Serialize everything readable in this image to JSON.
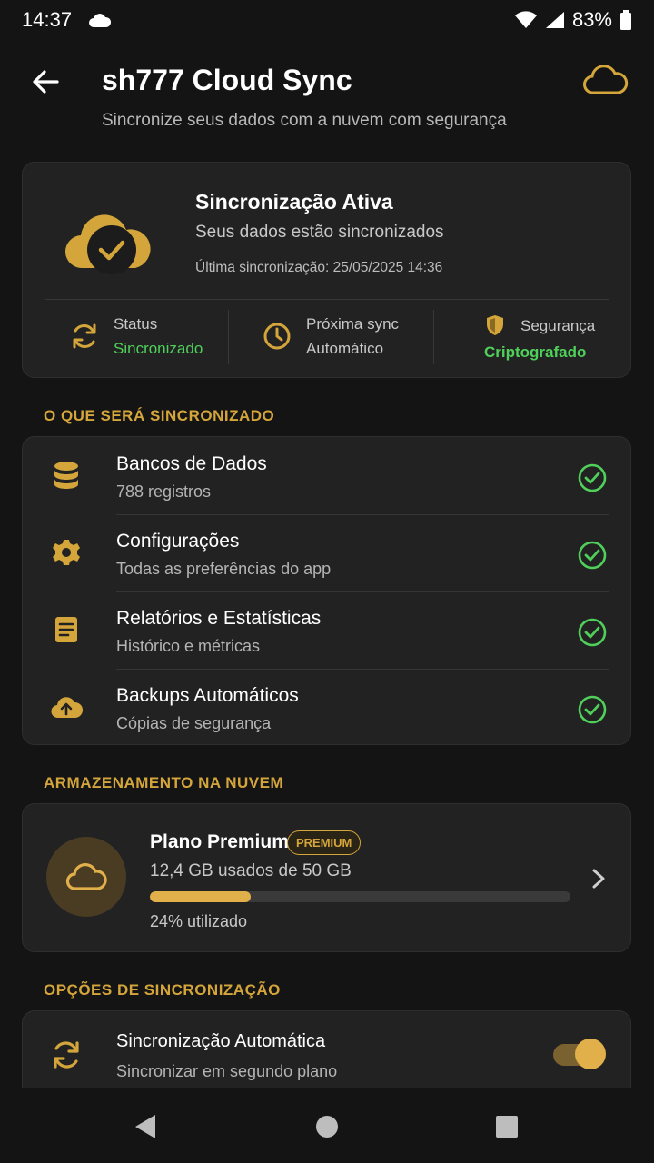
{
  "status_bar": {
    "time": "14:37",
    "battery": "83%"
  },
  "header": {
    "title": "sh777 Cloud Sync",
    "subtitle": "Sincronize seus dados com a nuvem com segurança"
  },
  "sync_status": {
    "title": "Sincronização Ativa",
    "subtitle": "Seus dados estão sincronizados",
    "last_sync": "Última sincronização: 25/05/2025 14:36",
    "stats": [
      {
        "label": "Status",
        "value": "Sincronizado"
      },
      {
        "label": "Próxima sync",
        "value": "Automático"
      },
      {
        "label": "Segurança",
        "value": "Criptografado"
      }
    ]
  },
  "what_sync": {
    "section_title": "O QUE SERÁ SINCRONIZADO",
    "items": [
      {
        "title": "Bancos de Dados",
        "subtitle": "788 registros",
        "icon": "database-icon"
      },
      {
        "title": "Configurações",
        "subtitle": "Todas as preferências do app",
        "icon": "gear-icon"
      },
      {
        "title": "Relatórios e Estatísticas",
        "subtitle": "Histórico e métricas",
        "icon": "report-icon"
      },
      {
        "title": "Backups Automáticos",
        "subtitle": "Cópias de segurança",
        "icon": "cloud-upload-icon"
      }
    ]
  },
  "storage": {
    "section_title": "ARMAZENAMENTO NA NUVEM",
    "plan": "Plano Premium",
    "badge": "PREMIUM",
    "used": "12,4 GB usados de 50 GB",
    "percent_label": "24% utilizado",
    "percent": 24
  },
  "options": {
    "section_title": "OPÇÕES DE SINCRONIZAÇÃO",
    "items": [
      {
        "title": "Sincronização Automática",
        "subtitle": "Sincronizar em segundo plano",
        "enabled": true
      }
    ]
  },
  "colors": {
    "accent": "#d4a53a",
    "success": "#4fd05a",
    "background": "#141414",
    "card": "#222222"
  }
}
